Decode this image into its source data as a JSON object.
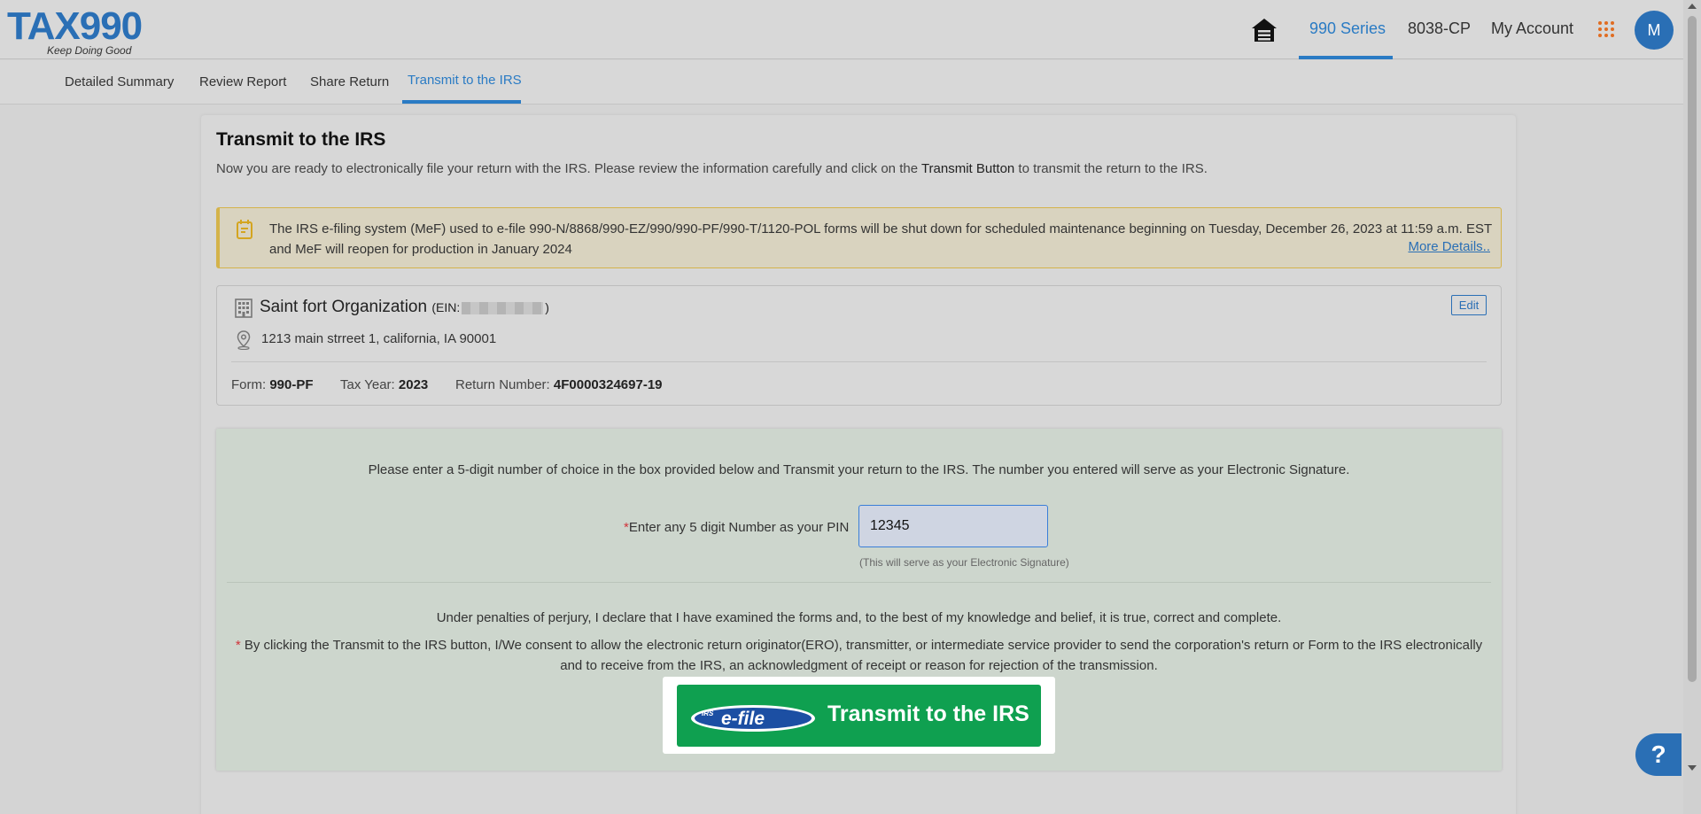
{
  "header": {
    "logo_main": "TAX990",
    "logo_tagline": "Keep Doing Good",
    "nav": [
      "990 Series",
      "8038-CP",
      "My Account"
    ],
    "avatar_initial": "M"
  },
  "subnav": {
    "tabs": [
      "Detailed Summary",
      "Review Report",
      "Share Return",
      "Transmit to the IRS"
    ]
  },
  "page": {
    "title": "Transmit to the IRS",
    "desc_prefix": "Now you are ready to electronically file your return with the IRS. Please review the information carefully and click on the ",
    "desc_bold": "Transmit Button",
    "desc_suffix": " to transmit the return to the IRS."
  },
  "notice": {
    "text": "The IRS e-filing system (MeF) used to e-file 990-N/8868/990-EZ/990/990-PF/990-T/1120-POL forms will be shut down for scheduled maintenance beginning on Tuesday, December 26, 2023 at 11:59 a.m. EST and MeF will reopen for production in January 2024",
    "more": "More Details.."
  },
  "organization": {
    "name": "Saint fort Organization",
    "ein_prefix": "(EIN:",
    "ein_suffix": ")",
    "address": "1213 main strreet 1, california, IA 90001",
    "edit": "Edit",
    "form_label": "Form:",
    "form_value": "990-PF",
    "year_label": "Tax Year:",
    "year_value": "2023",
    "return_label": "Return Number:",
    "return_value": "4F0000324697-19"
  },
  "signature": {
    "instruction": "Please enter a 5-digit number of choice in the box provided below and Transmit your return to the IRS. The number you entered will serve as your Electronic Signature.",
    "required_mark": "*",
    "pin_label": "Enter any 5 digit Number as your PIN",
    "pin_value": "12345",
    "pin_hint": "(This will serve as your Electronic Signature)",
    "perjury": "Under penalties of perjury, I declare that I have examined the forms and, to the best of my knowledge and belief, it is true, correct and complete.",
    "consent": "By clicking the Transmit to the IRS button, I/We consent to allow the electronic return originator(ERO), transmitter, or intermediate service provider to send the corporation's return or Form to the IRS electronically and to receive from the IRS, an acknowledgment of receipt or reason for rejection of the transmission."
  },
  "transmit": {
    "logo_small": "IRS",
    "logo_main": "e-file",
    "label": "Transmit to the IRS"
  },
  "help": {
    "label": "?"
  },
  "colors": {
    "accent": "#2a7bc4",
    "brand": "#2a6fb5",
    "transmit": "#0fa050",
    "required": "#d0333a",
    "apps": "#e06d22"
  }
}
